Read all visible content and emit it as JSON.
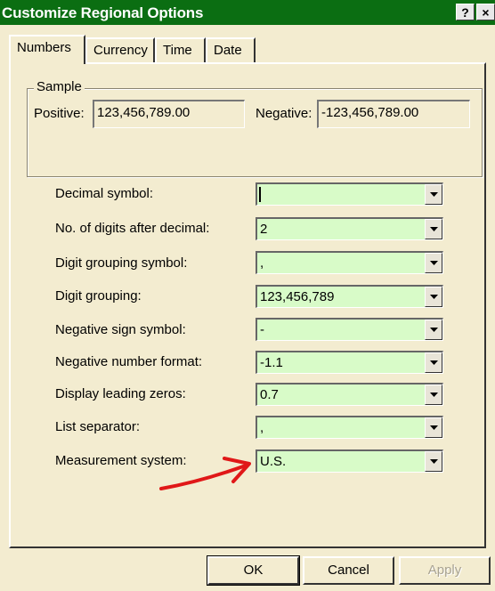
{
  "window": {
    "title": "Customize Regional Options",
    "help_label": "?",
    "close_label": "×"
  },
  "tabs": [
    {
      "label": "Numbers",
      "active": true
    },
    {
      "label": "Currency",
      "active": false
    },
    {
      "label": "Time",
      "active": false
    },
    {
      "label": "Date",
      "active": false
    }
  ],
  "sample": {
    "legend": "Sample",
    "positive_label": "Positive:",
    "positive_value": "123,456,789.00",
    "negative_label": "Negative:",
    "negative_value": "-123,456,789.00"
  },
  "settings": [
    {
      "label": "Decimal symbol:",
      "value": ""
    },
    {
      "label": "No. of digits after decimal:",
      "value": "2"
    },
    {
      "label": "Digit grouping symbol:",
      "value": ","
    },
    {
      "label": "Digit grouping:",
      "value": "123,456,789"
    },
    {
      "label": "Negative sign symbol:",
      "value": "-"
    },
    {
      "label": "Negative number format:",
      "value": "-1.1"
    },
    {
      "label": "Display leading zeros:",
      "value": "0.7"
    },
    {
      "label": "List separator:",
      "value": ","
    },
    {
      "label": "Measurement system:",
      "value": "U.S."
    }
  ],
  "buttons": {
    "ok": "OK",
    "cancel": "Cancel",
    "apply": "Apply"
  },
  "colors": {
    "titlebar": "#0b6e12",
    "dialog_bg": "#f3ecd0",
    "combo_bg": "#d8fbc8",
    "annotation_arrow": "#e01818"
  }
}
